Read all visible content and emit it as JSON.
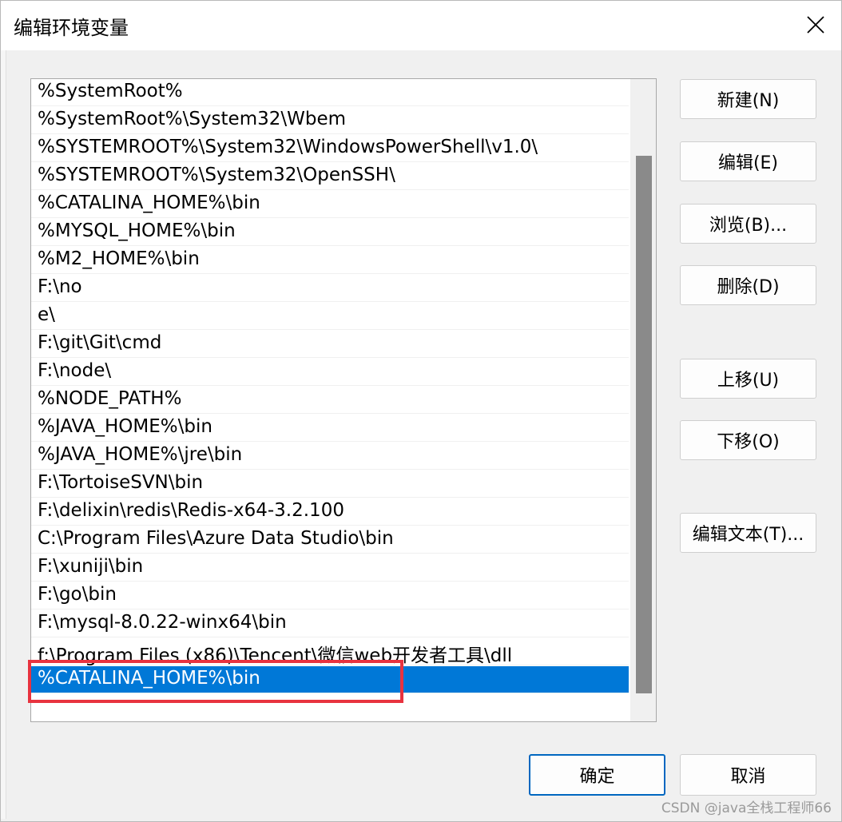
{
  "window": {
    "title": "编辑环境变量"
  },
  "list": {
    "items": [
      "%SystemRoot%",
      "%SystemRoot%\\System32\\Wbem",
      "%SYSTEMROOT%\\System32\\WindowsPowerShell\\v1.0\\",
      "%SYSTEMROOT%\\System32\\OpenSSH\\",
      "%CATALINA_HOME%\\bin",
      "%MYSQL_HOME%\\bin",
      "%M2_HOME%\\bin",
      "F:\\no",
      "e\\",
      "F:\\git\\Git\\cmd",
      "F:\\node\\",
      "%NODE_PATH%",
      "%JAVA_HOME%\\bin",
      "%JAVA_HOME%\\jre\\bin",
      "F:\\TortoiseSVN\\bin",
      "F:\\delixin\\redis\\Redis-x64-3.2.100",
      "C:\\Program Files\\Azure Data Studio\\bin",
      "F:\\xuniji\\bin",
      "F:\\go\\bin",
      "F:\\mysql-8.0.22-winx64\\bin",
      "f:\\Program Files (x86)\\Tencent\\微信web开发者工具\\dll",
      "%CATALINA_HOME%\\bin"
    ],
    "selected_index": 21
  },
  "buttons": {
    "new": "新建(N)",
    "edit": "编辑(E)",
    "browse": "浏览(B)...",
    "delete": "删除(D)",
    "move_up": "上移(U)",
    "move_down": "下移(O)",
    "edit_text": "编辑文本(T)...",
    "ok": "确定",
    "cancel": "取消"
  },
  "watermark": "CSDN @java全栈工程师66",
  "colors": {
    "selection": "#0078d7",
    "highlight_border": "#e8333f",
    "default_button_border": "#0067c0"
  },
  "icons": {
    "close": "close-icon"
  }
}
